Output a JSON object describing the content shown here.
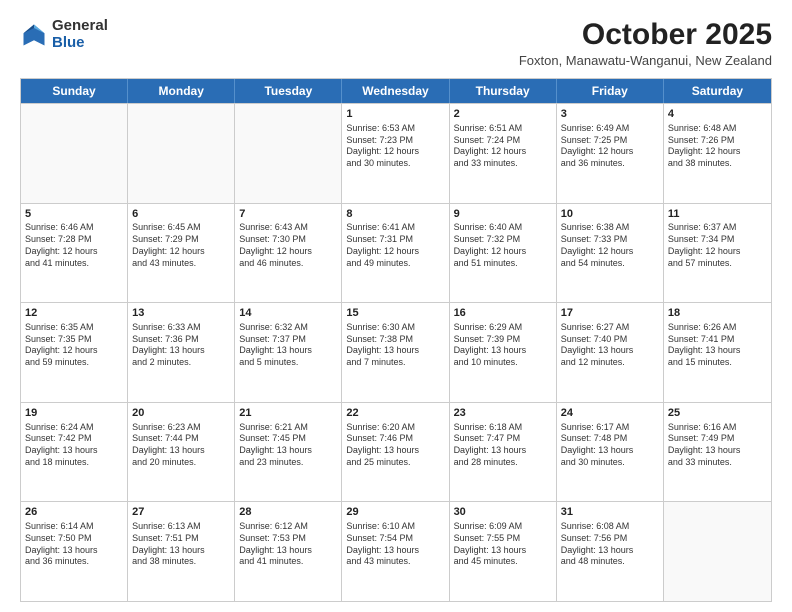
{
  "header": {
    "logo_general": "General",
    "logo_blue": "Blue",
    "month_title": "October 2025",
    "location": "Foxton, Manawatu-Wanganui, New Zealand"
  },
  "days_of_week": [
    "Sunday",
    "Monday",
    "Tuesday",
    "Wednesday",
    "Thursday",
    "Friday",
    "Saturday"
  ],
  "rows": [
    [
      {
        "date": "",
        "info": ""
      },
      {
        "date": "",
        "info": ""
      },
      {
        "date": "",
        "info": ""
      },
      {
        "date": "1",
        "info": "Sunrise: 6:53 AM\nSunset: 7:23 PM\nDaylight: 12 hours\nand 30 minutes."
      },
      {
        "date": "2",
        "info": "Sunrise: 6:51 AM\nSunset: 7:24 PM\nDaylight: 12 hours\nand 33 minutes."
      },
      {
        "date": "3",
        "info": "Sunrise: 6:49 AM\nSunset: 7:25 PM\nDaylight: 12 hours\nand 36 minutes."
      },
      {
        "date": "4",
        "info": "Sunrise: 6:48 AM\nSunset: 7:26 PM\nDaylight: 12 hours\nand 38 minutes."
      }
    ],
    [
      {
        "date": "5",
        "info": "Sunrise: 6:46 AM\nSunset: 7:28 PM\nDaylight: 12 hours\nand 41 minutes."
      },
      {
        "date": "6",
        "info": "Sunrise: 6:45 AM\nSunset: 7:29 PM\nDaylight: 12 hours\nand 43 minutes."
      },
      {
        "date": "7",
        "info": "Sunrise: 6:43 AM\nSunset: 7:30 PM\nDaylight: 12 hours\nand 46 minutes."
      },
      {
        "date": "8",
        "info": "Sunrise: 6:41 AM\nSunset: 7:31 PM\nDaylight: 12 hours\nand 49 minutes."
      },
      {
        "date": "9",
        "info": "Sunrise: 6:40 AM\nSunset: 7:32 PM\nDaylight: 12 hours\nand 51 minutes."
      },
      {
        "date": "10",
        "info": "Sunrise: 6:38 AM\nSunset: 7:33 PM\nDaylight: 12 hours\nand 54 minutes."
      },
      {
        "date": "11",
        "info": "Sunrise: 6:37 AM\nSunset: 7:34 PM\nDaylight: 12 hours\nand 57 minutes."
      }
    ],
    [
      {
        "date": "12",
        "info": "Sunrise: 6:35 AM\nSunset: 7:35 PM\nDaylight: 12 hours\nand 59 minutes."
      },
      {
        "date": "13",
        "info": "Sunrise: 6:33 AM\nSunset: 7:36 PM\nDaylight: 13 hours\nand 2 minutes."
      },
      {
        "date": "14",
        "info": "Sunrise: 6:32 AM\nSunset: 7:37 PM\nDaylight: 13 hours\nand 5 minutes."
      },
      {
        "date": "15",
        "info": "Sunrise: 6:30 AM\nSunset: 7:38 PM\nDaylight: 13 hours\nand 7 minutes."
      },
      {
        "date": "16",
        "info": "Sunrise: 6:29 AM\nSunset: 7:39 PM\nDaylight: 13 hours\nand 10 minutes."
      },
      {
        "date": "17",
        "info": "Sunrise: 6:27 AM\nSunset: 7:40 PM\nDaylight: 13 hours\nand 12 minutes."
      },
      {
        "date": "18",
        "info": "Sunrise: 6:26 AM\nSunset: 7:41 PM\nDaylight: 13 hours\nand 15 minutes."
      }
    ],
    [
      {
        "date": "19",
        "info": "Sunrise: 6:24 AM\nSunset: 7:42 PM\nDaylight: 13 hours\nand 18 minutes."
      },
      {
        "date": "20",
        "info": "Sunrise: 6:23 AM\nSunset: 7:44 PM\nDaylight: 13 hours\nand 20 minutes."
      },
      {
        "date": "21",
        "info": "Sunrise: 6:21 AM\nSunset: 7:45 PM\nDaylight: 13 hours\nand 23 minutes."
      },
      {
        "date": "22",
        "info": "Sunrise: 6:20 AM\nSunset: 7:46 PM\nDaylight: 13 hours\nand 25 minutes."
      },
      {
        "date": "23",
        "info": "Sunrise: 6:18 AM\nSunset: 7:47 PM\nDaylight: 13 hours\nand 28 minutes."
      },
      {
        "date": "24",
        "info": "Sunrise: 6:17 AM\nSunset: 7:48 PM\nDaylight: 13 hours\nand 30 minutes."
      },
      {
        "date": "25",
        "info": "Sunrise: 6:16 AM\nSunset: 7:49 PM\nDaylight: 13 hours\nand 33 minutes."
      }
    ],
    [
      {
        "date": "26",
        "info": "Sunrise: 6:14 AM\nSunset: 7:50 PM\nDaylight: 13 hours\nand 36 minutes."
      },
      {
        "date": "27",
        "info": "Sunrise: 6:13 AM\nSunset: 7:51 PM\nDaylight: 13 hours\nand 38 minutes."
      },
      {
        "date": "28",
        "info": "Sunrise: 6:12 AM\nSunset: 7:53 PM\nDaylight: 13 hours\nand 41 minutes."
      },
      {
        "date": "29",
        "info": "Sunrise: 6:10 AM\nSunset: 7:54 PM\nDaylight: 13 hours\nand 43 minutes."
      },
      {
        "date": "30",
        "info": "Sunrise: 6:09 AM\nSunset: 7:55 PM\nDaylight: 13 hours\nand 45 minutes."
      },
      {
        "date": "31",
        "info": "Sunrise: 6:08 AM\nSunset: 7:56 PM\nDaylight: 13 hours\nand 48 minutes."
      },
      {
        "date": "",
        "info": ""
      }
    ]
  ]
}
